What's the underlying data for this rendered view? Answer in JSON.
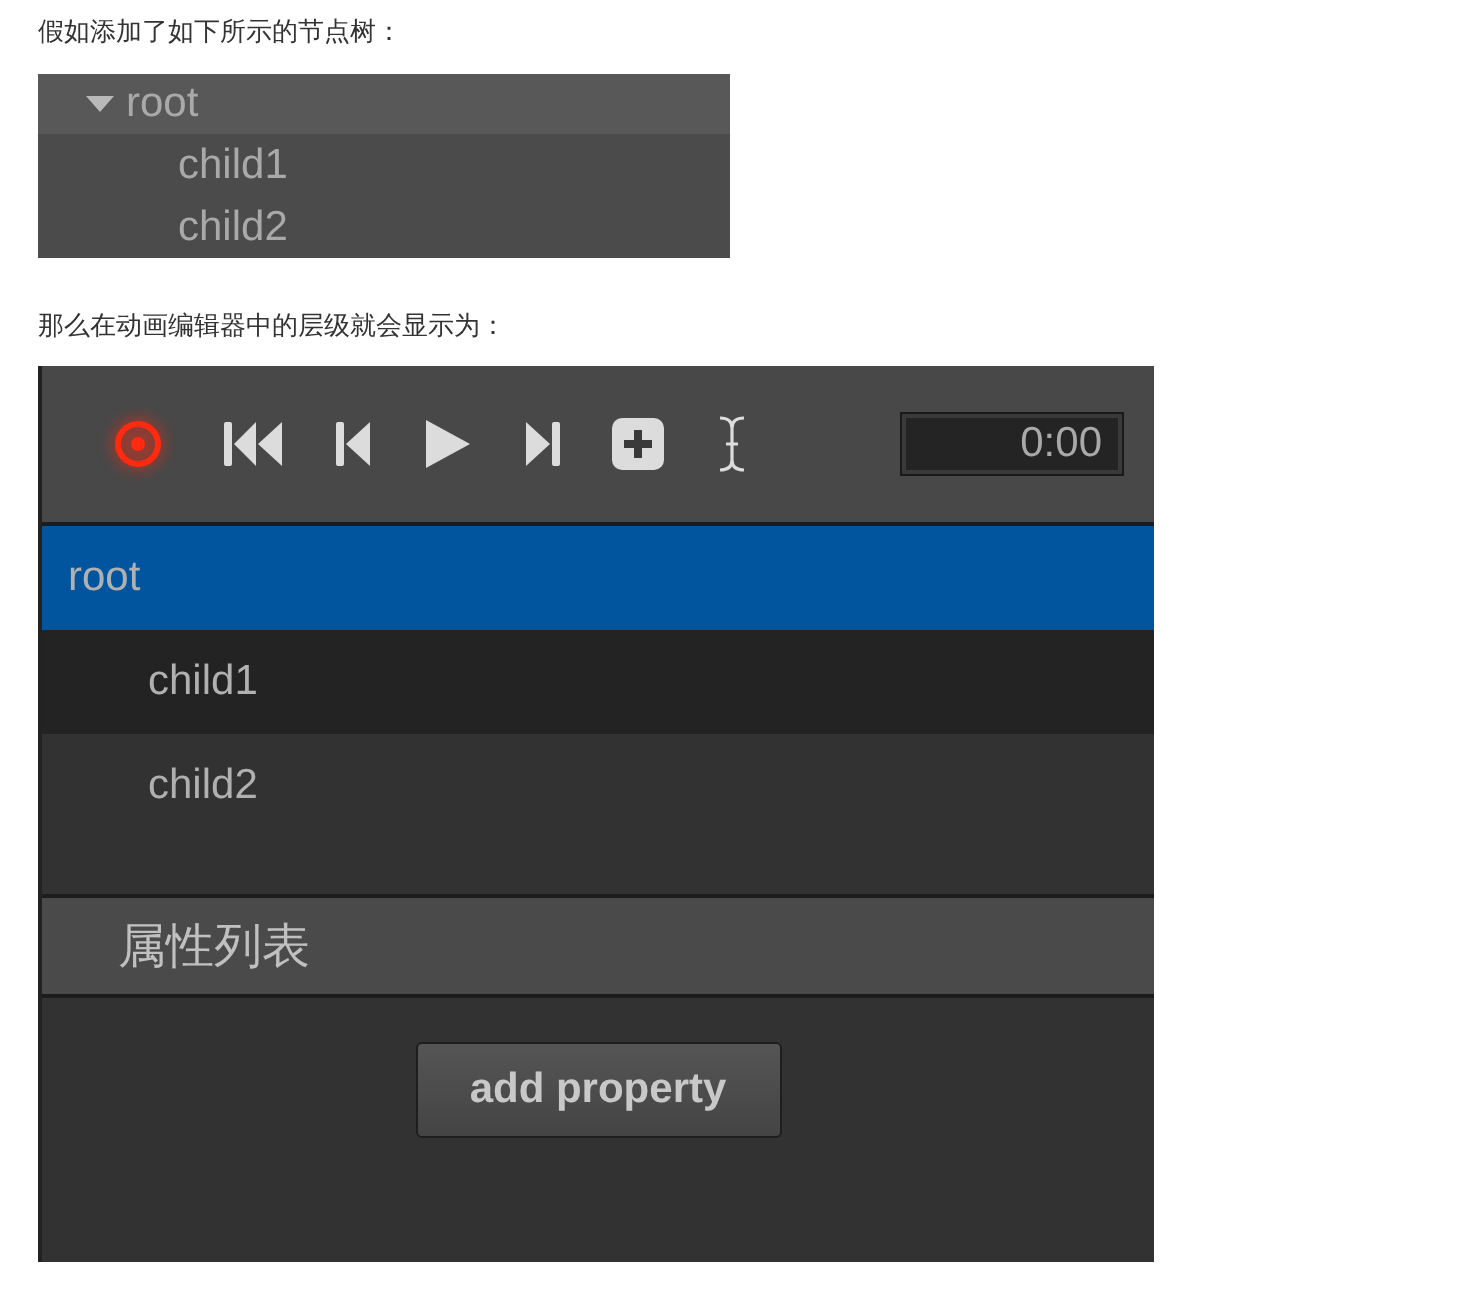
{
  "intro_text": "假如添加了如下所示的节点树：",
  "node_tree": {
    "items": [
      {
        "label": "root",
        "expanded": true,
        "children": [
          {
            "label": "child1"
          },
          {
            "label": "child2"
          }
        ]
      }
    ]
  },
  "result_text": "那么在动画编辑器中的层级就会显示为：",
  "animation_editor": {
    "time": "0:00",
    "hierarchy": [
      {
        "label": "root",
        "selected": true,
        "children": [
          {
            "label": "child1",
            "selected": false
          },
          {
            "label": "child2",
            "selected": false
          }
        ]
      }
    ],
    "property_header": "属性列表",
    "add_button": "add property"
  }
}
